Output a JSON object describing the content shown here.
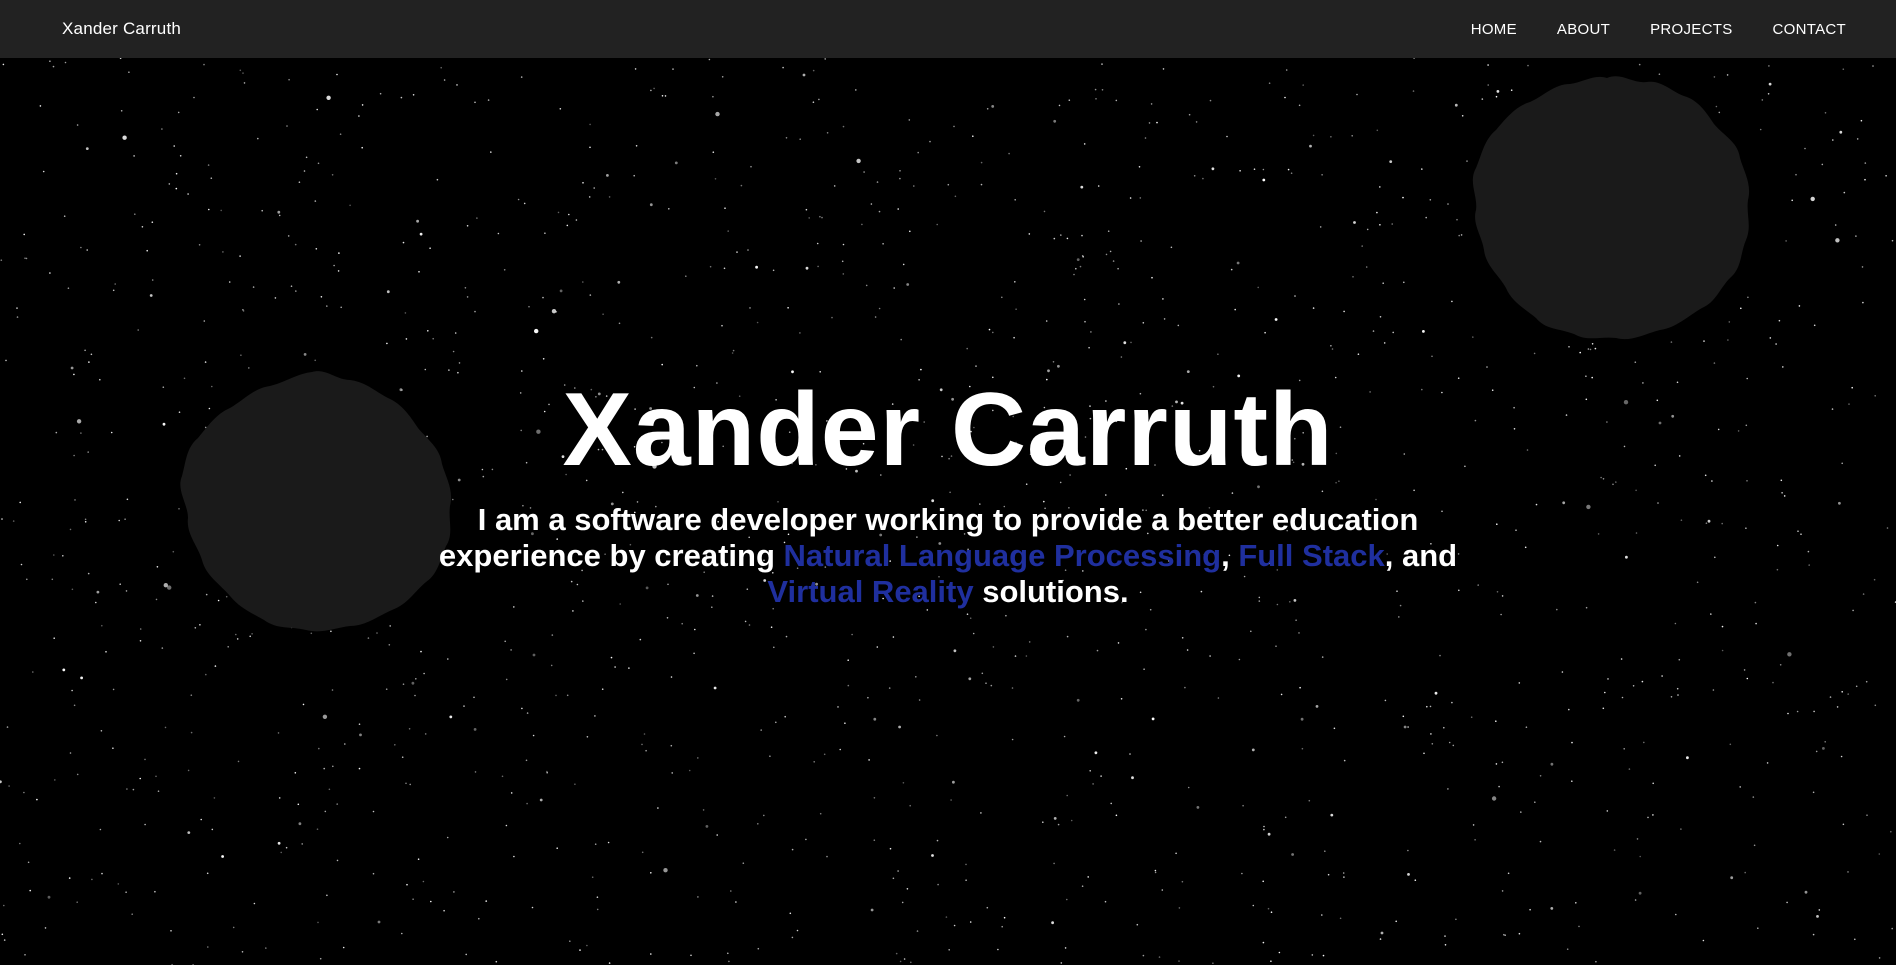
{
  "nav": {
    "brand": "Xander Carruth",
    "links": [
      {
        "label": "HOME"
      },
      {
        "label": "ABOUT"
      },
      {
        "label": "PROJECTS"
      },
      {
        "label": "CONTACT"
      }
    ]
  },
  "hero": {
    "title": "Xander Carruth",
    "intro_part1": "I am a software developer working to provide a better education experience by creating ",
    "skills": [
      {
        "label": "Natural Language Processing"
      },
      {
        "label": "Full Stack"
      },
      {
        "label": "Virtual Reality"
      }
    ],
    "sep1": ", ",
    "sep2": ", and ",
    "outro": " solutions."
  },
  "colors": {
    "background": "#000000",
    "navbar": "#222222",
    "text": "#ffffff",
    "accent": "#1f2f9e",
    "blob": "#1a1a1a"
  }
}
